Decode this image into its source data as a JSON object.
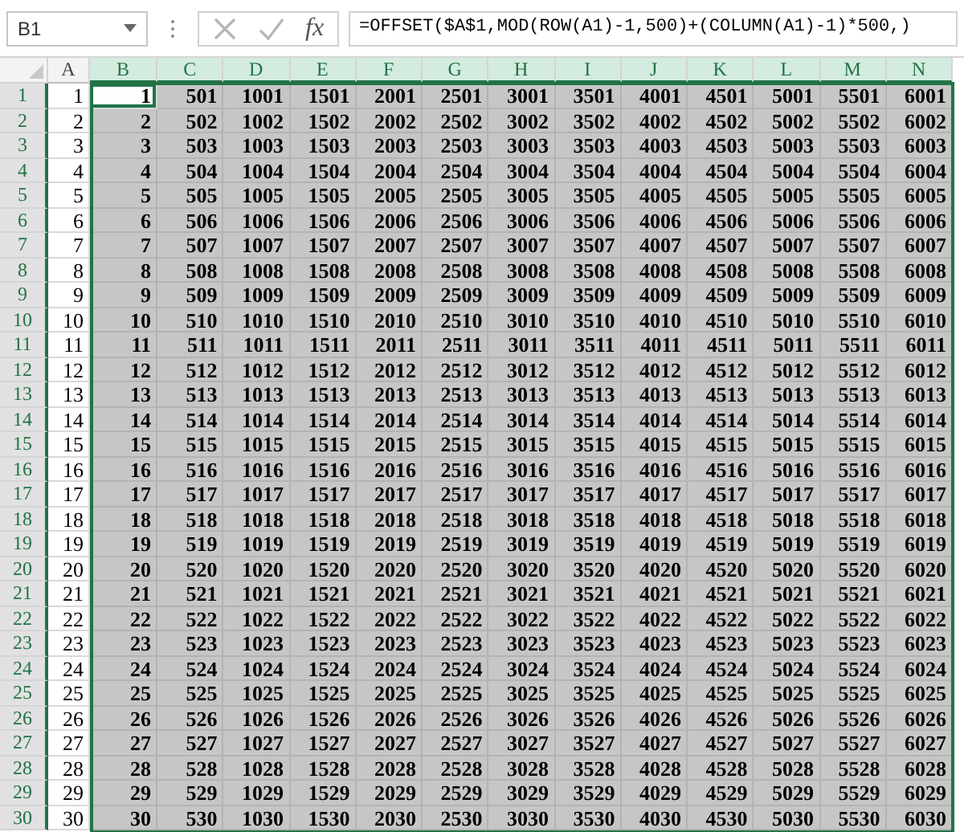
{
  "name_box": {
    "value": "B1"
  },
  "formula_bar": {
    "fx": "fx",
    "value": "=OFFSET($A$1,MOD(ROW(A1)-1,500)+(COLUMN(A1)-1)*500,)"
  },
  "columns": [
    {
      "label": "A",
      "selected": false
    },
    {
      "label": "B",
      "selected": true
    },
    {
      "label": "C",
      "selected": true
    },
    {
      "label": "D",
      "selected": true
    },
    {
      "label": "E",
      "selected": true
    },
    {
      "label": "F",
      "selected": true
    },
    {
      "label": "G",
      "selected": true
    },
    {
      "label": "H",
      "selected": true
    },
    {
      "label": "I",
      "selected": true
    },
    {
      "label": "J",
      "selected": true
    },
    {
      "label": "K",
      "selected": true
    },
    {
      "label": "L",
      "selected": true
    },
    {
      "label": "M",
      "selected": true
    },
    {
      "label": "N",
      "selected": true
    }
  ],
  "rows": [
    {
      "header": "1",
      "selected": true,
      "cells": [
        {
          "text": "1",
          "active": false
        },
        {
          "text": "1",
          "active": true
        },
        {
          "text": "501",
          "active": false
        },
        {
          "text": "1001",
          "active": false
        },
        {
          "text": "1501",
          "active": false
        },
        {
          "text": "2001",
          "active": false
        },
        {
          "text": "2501",
          "active": false
        },
        {
          "text": "3001",
          "active": false
        },
        {
          "text": "3501",
          "active": false
        },
        {
          "text": "4001",
          "active": false
        },
        {
          "text": "4501",
          "active": false
        },
        {
          "text": "5001",
          "active": false
        },
        {
          "text": "5501",
          "active": false
        },
        {
          "text": "6001",
          "active": false
        }
      ]
    },
    {
      "header": "2",
      "selected": true,
      "cells": [
        {
          "text": "2",
          "active": false
        },
        {
          "text": "2",
          "active": false
        },
        {
          "text": "502",
          "active": false
        },
        {
          "text": "1002",
          "active": false
        },
        {
          "text": "1502",
          "active": false
        },
        {
          "text": "2002",
          "active": false
        },
        {
          "text": "2502",
          "active": false
        },
        {
          "text": "3002",
          "active": false
        },
        {
          "text": "3502",
          "active": false
        },
        {
          "text": "4002",
          "active": false
        },
        {
          "text": "4502",
          "active": false
        },
        {
          "text": "5002",
          "active": false
        },
        {
          "text": "5502",
          "active": false
        },
        {
          "text": "6002",
          "active": false
        }
      ]
    },
    {
      "header": "3",
      "selected": true,
      "cells": [
        {
          "text": "3",
          "active": false
        },
        {
          "text": "3",
          "active": false
        },
        {
          "text": "503",
          "active": false
        },
        {
          "text": "1003",
          "active": false
        },
        {
          "text": "1503",
          "active": false
        },
        {
          "text": "2003",
          "active": false
        },
        {
          "text": "2503",
          "active": false
        },
        {
          "text": "3003",
          "active": false
        },
        {
          "text": "3503",
          "active": false
        },
        {
          "text": "4003",
          "active": false
        },
        {
          "text": "4503",
          "active": false
        },
        {
          "text": "5003",
          "active": false
        },
        {
          "text": "5503",
          "active": false
        },
        {
          "text": "6003",
          "active": false
        }
      ]
    },
    {
      "header": "4",
      "selected": true,
      "cells": [
        {
          "text": "4",
          "active": false
        },
        {
          "text": "4",
          "active": false
        },
        {
          "text": "504",
          "active": false
        },
        {
          "text": "1004",
          "active": false
        },
        {
          "text": "1504",
          "active": false
        },
        {
          "text": "2004",
          "active": false
        },
        {
          "text": "2504",
          "active": false
        },
        {
          "text": "3004",
          "active": false
        },
        {
          "text": "3504",
          "active": false
        },
        {
          "text": "4004",
          "active": false
        },
        {
          "text": "4504",
          "active": false
        },
        {
          "text": "5004",
          "active": false
        },
        {
          "text": "5504",
          "active": false
        },
        {
          "text": "6004",
          "active": false
        }
      ]
    },
    {
      "header": "5",
      "selected": true,
      "cells": [
        {
          "text": "5",
          "active": false
        },
        {
          "text": "5",
          "active": false
        },
        {
          "text": "505",
          "active": false
        },
        {
          "text": "1005",
          "active": false
        },
        {
          "text": "1505",
          "active": false
        },
        {
          "text": "2005",
          "active": false
        },
        {
          "text": "2505",
          "active": false
        },
        {
          "text": "3005",
          "active": false
        },
        {
          "text": "3505",
          "active": false
        },
        {
          "text": "4005",
          "active": false
        },
        {
          "text": "4505",
          "active": false
        },
        {
          "text": "5005",
          "active": false
        },
        {
          "text": "5505",
          "active": false
        },
        {
          "text": "6005",
          "active": false
        }
      ]
    },
    {
      "header": "6",
      "selected": true,
      "cells": [
        {
          "text": "6",
          "active": false
        },
        {
          "text": "6",
          "active": false
        },
        {
          "text": "506",
          "active": false
        },
        {
          "text": "1006",
          "active": false
        },
        {
          "text": "1506",
          "active": false
        },
        {
          "text": "2006",
          "active": false
        },
        {
          "text": "2506",
          "active": false
        },
        {
          "text": "3006",
          "active": false
        },
        {
          "text": "3506",
          "active": false
        },
        {
          "text": "4006",
          "active": false
        },
        {
          "text": "4506",
          "active": false
        },
        {
          "text": "5006",
          "active": false
        },
        {
          "text": "5506",
          "active": false
        },
        {
          "text": "6006",
          "active": false
        }
      ]
    },
    {
      "header": "7",
      "selected": true,
      "cells": [
        {
          "text": "7",
          "active": false
        },
        {
          "text": "7",
          "active": false
        },
        {
          "text": "507",
          "active": false
        },
        {
          "text": "1007",
          "active": false
        },
        {
          "text": "1507",
          "active": false
        },
        {
          "text": "2007",
          "active": false
        },
        {
          "text": "2507",
          "active": false
        },
        {
          "text": "3007",
          "active": false
        },
        {
          "text": "3507",
          "active": false
        },
        {
          "text": "4007",
          "active": false
        },
        {
          "text": "4507",
          "active": false
        },
        {
          "text": "5007",
          "active": false
        },
        {
          "text": "5507",
          "active": false
        },
        {
          "text": "6007",
          "active": false
        }
      ]
    },
    {
      "header": "8",
      "selected": true,
      "cells": [
        {
          "text": "8",
          "active": false
        },
        {
          "text": "8",
          "active": false
        },
        {
          "text": "508",
          "active": false
        },
        {
          "text": "1008",
          "active": false
        },
        {
          "text": "1508",
          "active": false
        },
        {
          "text": "2008",
          "active": false
        },
        {
          "text": "2508",
          "active": false
        },
        {
          "text": "3008",
          "active": false
        },
        {
          "text": "3508",
          "active": false
        },
        {
          "text": "4008",
          "active": false
        },
        {
          "text": "4508",
          "active": false
        },
        {
          "text": "5008",
          "active": false
        },
        {
          "text": "5508",
          "active": false
        },
        {
          "text": "6008",
          "active": false
        }
      ]
    },
    {
      "header": "9",
      "selected": true,
      "cells": [
        {
          "text": "9",
          "active": false
        },
        {
          "text": "9",
          "active": false
        },
        {
          "text": "509",
          "active": false
        },
        {
          "text": "1009",
          "active": false
        },
        {
          "text": "1509",
          "active": false
        },
        {
          "text": "2009",
          "active": false
        },
        {
          "text": "2509",
          "active": false
        },
        {
          "text": "3009",
          "active": false
        },
        {
          "text": "3509",
          "active": false
        },
        {
          "text": "4009",
          "active": false
        },
        {
          "text": "4509",
          "active": false
        },
        {
          "text": "5009",
          "active": false
        },
        {
          "text": "5509",
          "active": false
        },
        {
          "text": "6009",
          "active": false
        }
      ]
    },
    {
      "header": "10",
      "selected": true,
      "cells": [
        {
          "text": "10",
          "active": false
        },
        {
          "text": "10",
          "active": false
        },
        {
          "text": "510",
          "active": false
        },
        {
          "text": "1010",
          "active": false
        },
        {
          "text": "1510",
          "active": false
        },
        {
          "text": "2010",
          "active": false
        },
        {
          "text": "2510",
          "active": false
        },
        {
          "text": "3010",
          "active": false
        },
        {
          "text": "3510",
          "active": false
        },
        {
          "text": "4010",
          "active": false
        },
        {
          "text": "4510",
          "active": false
        },
        {
          "text": "5010",
          "active": false
        },
        {
          "text": "5510",
          "active": false
        },
        {
          "text": "6010",
          "active": false
        }
      ]
    },
    {
      "header": "11",
      "selected": true,
      "cells": [
        {
          "text": "11",
          "active": false
        },
        {
          "text": "11",
          "active": false
        },
        {
          "text": "511",
          "active": false
        },
        {
          "text": "1011",
          "active": false
        },
        {
          "text": "1511",
          "active": false
        },
        {
          "text": "2011",
          "active": false
        },
        {
          "text": "2511",
          "active": false
        },
        {
          "text": "3011",
          "active": false
        },
        {
          "text": "3511",
          "active": false
        },
        {
          "text": "4011",
          "active": false
        },
        {
          "text": "4511",
          "active": false
        },
        {
          "text": "5011",
          "active": false
        },
        {
          "text": "5511",
          "active": false
        },
        {
          "text": "6011",
          "active": false
        }
      ]
    },
    {
      "header": "12",
      "selected": true,
      "cells": [
        {
          "text": "12",
          "active": false
        },
        {
          "text": "12",
          "active": false
        },
        {
          "text": "512",
          "active": false
        },
        {
          "text": "1012",
          "active": false
        },
        {
          "text": "1512",
          "active": false
        },
        {
          "text": "2012",
          "active": false
        },
        {
          "text": "2512",
          "active": false
        },
        {
          "text": "3012",
          "active": false
        },
        {
          "text": "3512",
          "active": false
        },
        {
          "text": "4012",
          "active": false
        },
        {
          "text": "4512",
          "active": false
        },
        {
          "text": "5012",
          "active": false
        },
        {
          "text": "5512",
          "active": false
        },
        {
          "text": "6012",
          "active": false
        }
      ]
    },
    {
      "header": "13",
      "selected": true,
      "cells": [
        {
          "text": "13",
          "active": false
        },
        {
          "text": "13",
          "active": false
        },
        {
          "text": "513",
          "active": false
        },
        {
          "text": "1013",
          "active": false
        },
        {
          "text": "1513",
          "active": false
        },
        {
          "text": "2013",
          "active": false
        },
        {
          "text": "2513",
          "active": false
        },
        {
          "text": "3013",
          "active": false
        },
        {
          "text": "3513",
          "active": false
        },
        {
          "text": "4013",
          "active": false
        },
        {
          "text": "4513",
          "active": false
        },
        {
          "text": "5013",
          "active": false
        },
        {
          "text": "5513",
          "active": false
        },
        {
          "text": "6013",
          "active": false
        }
      ]
    },
    {
      "header": "14",
      "selected": true,
      "cells": [
        {
          "text": "14",
          "active": false
        },
        {
          "text": "14",
          "active": false
        },
        {
          "text": "514",
          "active": false
        },
        {
          "text": "1014",
          "active": false
        },
        {
          "text": "1514",
          "active": false
        },
        {
          "text": "2014",
          "active": false
        },
        {
          "text": "2514",
          "active": false
        },
        {
          "text": "3014",
          "active": false
        },
        {
          "text": "3514",
          "active": false
        },
        {
          "text": "4014",
          "active": false
        },
        {
          "text": "4514",
          "active": false
        },
        {
          "text": "5014",
          "active": false
        },
        {
          "text": "5514",
          "active": false
        },
        {
          "text": "6014",
          "active": false
        }
      ]
    },
    {
      "header": "15",
      "selected": true,
      "cells": [
        {
          "text": "15",
          "active": false
        },
        {
          "text": "15",
          "active": false
        },
        {
          "text": "515",
          "active": false
        },
        {
          "text": "1015",
          "active": false
        },
        {
          "text": "1515",
          "active": false
        },
        {
          "text": "2015",
          "active": false
        },
        {
          "text": "2515",
          "active": false
        },
        {
          "text": "3015",
          "active": false
        },
        {
          "text": "3515",
          "active": false
        },
        {
          "text": "4015",
          "active": false
        },
        {
          "text": "4515",
          "active": false
        },
        {
          "text": "5015",
          "active": false
        },
        {
          "text": "5515",
          "active": false
        },
        {
          "text": "6015",
          "active": false
        }
      ]
    },
    {
      "header": "16",
      "selected": true,
      "cells": [
        {
          "text": "16",
          "active": false
        },
        {
          "text": "16",
          "active": false
        },
        {
          "text": "516",
          "active": false
        },
        {
          "text": "1016",
          "active": false
        },
        {
          "text": "1516",
          "active": false
        },
        {
          "text": "2016",
          "active": false
        },
        {
          "text": "2516",
          "active": false
        },
        {
          "text": "3016",
          "active": false
        },
        {
          "text": "3516",
          "active": false
        },
        {
          "text": "4016",
          "active": false
        },
        {
          "text": "4516",
          "active": false
        },
        {
          "text": "5016",
          "active": false
        },
        {
          "text": "5516",
          "active": false
        },
        {
          "text": "6016",
          "active": false
        }
      ]
    },
    {
      "header": "17",
      "selected": true,
      "cells": [
        {
          "text": "17",
          "active": false
        },
        {
          "text": "17",
          "active": false
        },
        {
          "text": "517",
          "active": false
        },
        {
          "text": "1017",
          "active": false
        },
        {
          "text": "1517",
          "active": false
        },
        {
          "text": "2017",
          "active": false
        },
        {
          "text": "2517",
          "active": false
        },
        {
          "text": "3017",
          "active": false
        },
        {
          "text": "3517",
          "active": false
        },
        {
          "text": "4017",
          "active": false
        },
        {
          "text": "4517",
          "active": false
        },
        {
          "text": "5017",
          "active": false
        },
        {
          "text": "5517",
          "active": false
        },
        {
          "text": "6017",
          "active": false
        }
      ]
    },
    {
      "header": "18",
      "selected": true,
      "cells": [
        {
          "text": "18",
          "active": false
        },
        {
          "text": "18",
          "active": false
        },
        {
          "text": "518",
          "active": false
        },
        {
          "text": "1018",
          "active": false
        },
        {
          "text": "1518",
          "active": false
        },
        {
          "text": "2018",
          "active": false
        },
        {
          "text": "2518",
          "active": false
        },
        {
          "text": "3018",
          "active": false
        },
        {
          "text": "3518",
          "active": false
        },
        {
          "text": "4018",
          "active": false
        },
        {
          "text": "4518",
          "active": false
        },
        {
          "text": "5018",
          "active": false
        },
        {
          "text": "5518",
          "active": false
        },
        {
          "text": "6018",
          "active": false
        }
      ]
    },
    {
      "header": "19",
      "selected": true,
      "cells": [
        {
          "text": "19",
          "active": false
        },
        {
          "text": "19",
          "active": false
        },
        {
          "text": "519",
          "active": false
        },
        {
          "text": "1019",
          "active": false
        },
        {
          "text": "1519",
          "active": false
        },
        {
          "text": "2019",
          "active": false
        },
        {
          "text": "2519",
          "active": false
        },
        {
          "text": "3019",
          "active": false
        },
        {
          "text": "3519",
          "active": false
        },
        {
          "text": "4019",
          "active": false
        },
        {
          "text": "4519",
          "active": false
        },
        {
          "text": "5019",
          "active": false
        },
        {
          "text": "5519",
          "active": false
        },
        {
          "text": "6019",
          "active": false
        }
      ]
    },
    {
      "header": "20",
      "selected": true,
      "cells": [
        {
          "text": "20",
          "active": false
        },
        {
          "text": "20",
          "active": false
        },
        {
          "text": "520",
          "active": false
        },
        {
          "text": "1020",
          "active": false
        },
        {
          "text": "1520",
          "active": false
        },
        {
          "text": "2020",
          "active": false
        },
        {
          "text": "2520",
          "active": false
        },
        {
          "text": "3020",
          "active": false
        },
        {
          "text": "3520",
          "active": false
        },
        {
          "text": "4020",
          "active": false
        },
        {
          "text": "4520",
          "active": false
        },
        {
          "text": "5020",
          "active": false
        },
        {
          "text": "5520",
          "active": false
        },
        {
          "text": "6020",
          "active": false
        }
      ]
    },
    {
      "header": "21",
      "selected": true,
      "cells": [
        {
          "text": "21",
          "active": false
        },
        {
          "text": "21",
          "active": false
        },
        {
          "text": "521",
          "active": false
        },
        {
          "text": "1021",
          "active": false
        },
        {
          "text": "1521",
          "active": false
        },
        {
          "text": "2021",
          "active": false
        },
        {
          "text": "2521",
          "active": false
        },
        {
          "text": "3021",
          "active": false
        },
        {
          "text": "3521",
          "active": false
        },
        {
          "text": "4021",
          "active": false
        },
        {
          "text": "4521",
          "active": false
        },
        {
          "text": "5021",
          "active": false
        },
        {
          "text": "5521",
          "active": false
        },
        {
          "text": "6021",
          "active": false
        }
      ]
    },
    {
      "header": "22",
      "selected": true,
      "cells": [
        {
          "text": "22",
          "active": false
        },
        {
          "text": "22",
          "active": false
        },
        {
          "text": "522",
          "active": false
        },
        {
          "text": "1022",
          "active": false
        },
        {
          "text": "1522",
          "active": false
        },
        {
          "text": "2022",
          "active": false
        },
        {
          "text": "2522",
          "active": false
        },
        {
          "text": "3022",
          "active": false
        },
        {
          "text": "3522",
          "active": false
        },
        {
          "text": "4022",
          "active": false
        },
        {
          "text": "4522",
          "active": false
        },
        {
          "text": "5022",
          "active": false
        },
        {
          "text": "5522",
          "active": false
        },
        {
          "text": "6022",
          "active": false
        }
      ]
    },
    {
      "header": "23",
      "selected": true,
      "cells": [
        {
          "text": "23",
          "active": false
        },
        {
          "text": "23",
          "active": false
        },
        {
          "text": "523",
          "active": false
        },
        {
          "text": "1023",
          "active": false
        },
        {
          "text": "1523",
          "active": false
        },
        {
          "text": "2023",
          "active": false
        },
        {
          "text": "2523",
          "active": false
        },
        {
          "text": "3023",
          "active": false
        },
        {
          "text": "3523",
          "active": false
        },
        {
          "text": "4023",
          "active": false
        },
        {
          "text": "4523",
          "active": false
        },
        {
          "text": "5023",
          "active": false
        },
        {
          "text": "5523",
          "active": false
        },
        {
          "text": "6023",
          "active": false
        }
      ]
    },
    {
      "header": "24",
      "selected": true,
      "cells": [
        {
          "text": "24",
          "active": false
        },
        {
          "text": "24",
          "active": false
        },
        {
          "text": "524",
          "active": false
        },
        {
          "text": "1024",
          "active": false
        },
        {
          "text": "1524",
          "active": false
        },
        {
          "text": "2024",
          "active": false
        },
        {
          "text": "2524",
          "active": false
        },
        {
          "text": "3024",
          "active": false
        },
        {
          "text": "3524",
          "active": false
        },
        {
          "text": "4024",
          "active": false
        },
        {
          "text": "4524",
          "active": false
        },
        {
          "text": "5024",
          "active": false
        },
        {
          "text": "5524",
          "active": false
        },
        {
          "text": "6024",
          "active": false
        }
      ]
    },
    {
      "header": "25",
      "selected": true,
      "cells": [
        {
          "text": "25",
          "active": false
        },
        {
          "text": "25",
          "active": false
        },
        {
          "text": "525",
          "active": false
        },
        {
          "text": "1025",
          "active": false
        },
        {
          "text": "1525",
          "active": false
        },
        {
          "text": "2025",
          "active": false
        },
        {
          "text": "2525",
          "active": false
        },
        {
          "text": "3025",
          "active": false
        },
        {
          "text": "3525",
          "active": false
        },
        {
          "text": "4025",
          "active": false
        },
        {
          "text": "4525",
          "active": false
        },
        {
          "text": "5025",
          "active": false
        },
        {
          "text": "5525",
          "active": false
        },
        {
          "text": "6025",
          "active": false
        }
      ]
    },
    {
      "header": "26",
      "selected": true,
      "cells": [
        {
          "text": "26",
          "active": false
        },
        {
          "text": "26",
          "active": false
        },
        {
          "text": "526",
          "active": false
        },
        {
          "text": "1026",
          "active": false
        },
        {
          "text": "1526",
          "active": false
        },
        {
          "text": "2026",
          "active": false
        },
        {
          "text": "2526",
          "active": false
        },
        {
          "text": "3026",
          "active": false
        },
        {
          "text": "3526",
          "active": false
        },
        {
          "text": "4026",
          "active": false
        },
        {
          "text": "4526",
          "active": false
        },
        {
          "text": "5026",
          "active": false
        },
        {
          "text": "5526",
          "active": false
        },
        {
          "text": "6026",
          "active": false
        }
      ]
    },
    {
      "header": "27",
      "selected": true,
      "cells": [
        {
          "text": "27",
          "active": false
        },
        {
          "text": "27",
          "active": false
        },
        {
          "text": "527",
          "active": false
        },
        {
          "text": "1027",
          "active": false
        },
        {
          "text": "1527",
          "active": false
        },
        {
          "text": "2027",
          "active": false
        },
        {
          "text": "2527",
          "active": false
        },
        {
          "text": "3027",
          "active": false
        },
        {
          "text": "3527",
          "active": false
        },
        {
          "text": "4027",
          "active": false
        },
        {
          "text": "4527",
          "active": false
        },
        {
          "text": "5027",
          "active": false
        },
        {
          "text": "5527",
          "active": false
        },
        {
          "text": "6027",
          "active": false
        }
      ]
    },
    {
      "header": "28",
      "selected": true,
      "cells": [
        {
          "text": "28",
          "active": false
        },
        {
          "text": "28",
          "active": false
        },
        {
          "text": "528",
          "active": false
        },
        {
          "text": "1028",
          "active": false
        },
        {
          "text": "1528",
          "active": false
        },
        {
          "text": "2028",
          "active": false
        },
        {
          "text": "2528",
          "active": false
        },
        {
          "text": "3028",
          "active": false
        },
        {
          "text": "3528",
          "active": false
        },
        {
          "text": "4028",
          "active": false
        },
        {
          "text": "4528",
          "active": false
        },
        {
          "text": "5028",
          "active": false
        },
        {
          "text": "5528",
          "active": false
        },
        {
          "text": "6028",
          "active": false
        }
      ]
    },
    {
      "header": "29",
      "selected": true,
      "cells": [
        {
          "text": "29",
          "active": false
        },
        {
          "text": "29",
          "active": false
        },
        {
          "text": "529",
          "active": false
        },
        {
          "text": "1029",
          "active": false
        },
        {
          "text": "1529",
          "active": false
        },
        {
          "text": "2029",
          "active": false
        },
        {
          "text": "2529",
          "active": false
        },
        {
          "text": "3029",
          "active": false
        },
        {
          "text": "3529",
          "active": false
        },
        {
          "text": "4029",
          "active": false
        },
        {
          "text": "4529",
          "active": false
        },
        {
          "text": "5029",
          "active": false
        },
        {
          "text": "5529",
          "active": false
        },
        {
          "text": "6029",
          "active": false
        }
      ]
    },
    {
      "header": "30",
      "selected": true,
      "cells": [
        {
          "text": "30",
          "active": false
        },
        {
          "text": "30",
          "active": false
        },
        {
          "text": "530",
          "active": false
        },
        {
          "text": "1030",
          "active": false
        },
        {
          "text": "1530",
          "active": false
        },
        {
          "text": "2030",
          "active": false
        },
        {
          "text": "2530",
          "active": false
        },
        {
          "text": "3030",
          "active": false
        },
        {
          "text": "3530",
          "active": false
        },
        {
          "text": "4030",
          "active": false
        },
        {
          "text": "4530",
          "active": false
        },
        {
          "text": "5030",
          "active": false
        },
        {
          "text": "5530",
          "active": false
        },
        {
          "text": "6030",
          "active": false
        }
      ]
    }
  ]
}
